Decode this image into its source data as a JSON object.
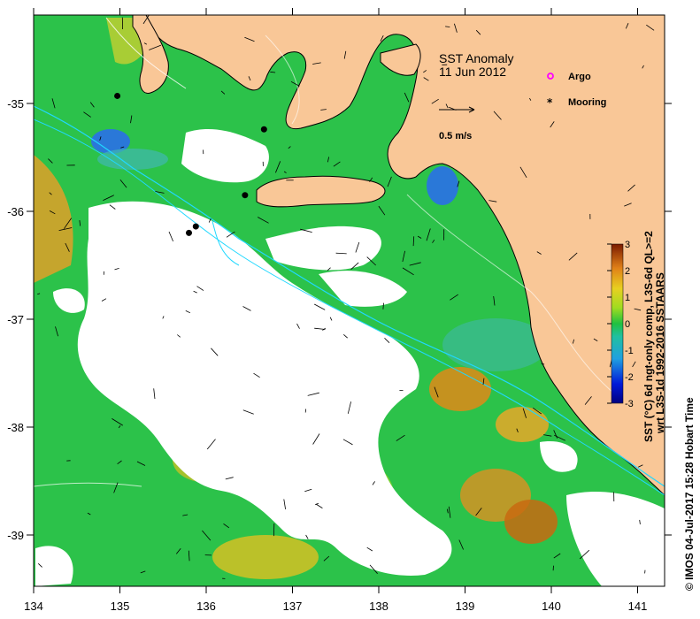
{
  "title": "SST Anomaly",
  "date": "11 Jun 2012",
  "legend": {
    "argo": "Argo",
    "mooring": "Mooring",
    "vector_scale": "0.5 m/s"
  },
  "colorbar": {
    "label_line1": "SST (°C) 6d ngt-only comp, L3S-6d QL>=2",
    "label_line2": "wrt L3S-1d 1992-2016 SSTAARS",
    "ticks": [
      "3",
      "2",
      "1",
      "0",
      "-1",
      "-2",
      "-3"
    ],
    "min": -3,
    "max": 3
  },
  "credit": "© IMOS 04-Jul-2017 15:28 Hobart Time",
  "axes": {
    "x_ticks": [
      "134",
      "135",
      "136",
      "137",
      "138",
      "139",
      "140",
      "141"
    ],
    "y_ticks": [
      "-35",
      "-36",
      "-37",
      "-38",
      "-39"
    ]
  },
  "colors": {
    "land": "#f9c797",
    "no_data": "#ffffff",
    "sea_anomaly_zero": "#21c44a",
    "positive": "#e8a020",
    "negative": "#1e78dc",
    "argo": "#ff00ff",
    "mooring": "#000000"
  },
  "moorings": [
    {
      "lon": 134.97,
      "lat": -34.93
    },
    {
      "lon": 136.67,
      "lat": -35.24
    },
    {
      "lon": 136.45,
      "lat": -35.85
    },
    {
      "lon": 135.88,
      "lat": -36.14
    },
    {
      "lon": 135.8,
      "lat": -36.2
    }
  ]
}
